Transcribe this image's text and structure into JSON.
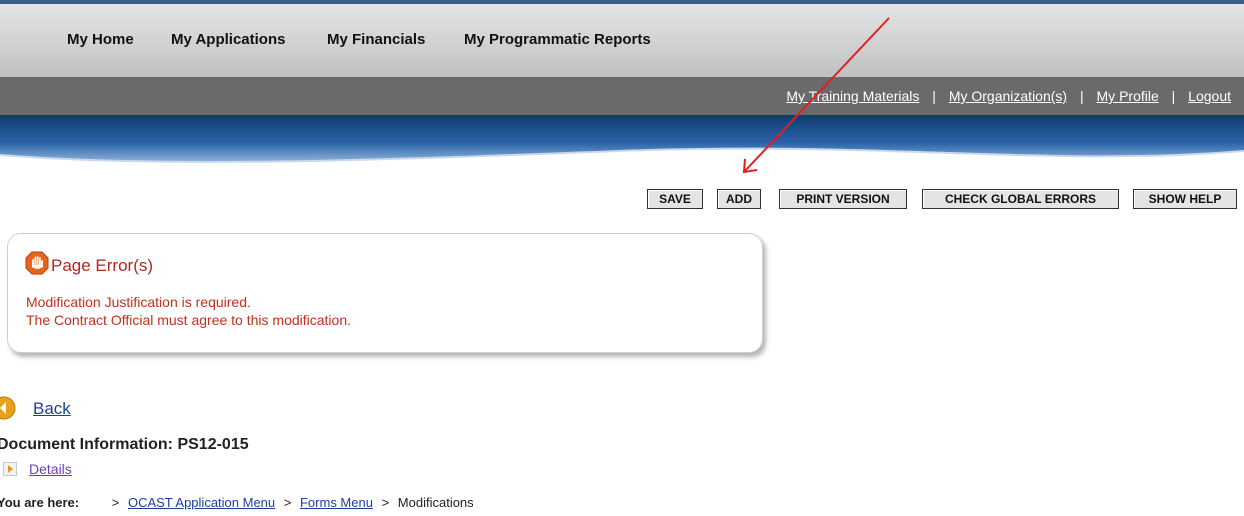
{
  "topnav": {
    "items": [
      "My Home",
      "My Applications",
      "My Financials",
      "My Programmatic Reports"
    ]
  },
  "subnav": {
    "links": [
      "My Training Materials",
      "My Organization(s)",
      "My Profile",
      "Logout"
    ],
    "separator": "|"
  },
  "toolbar": {
    "buttons": [
      "SAVE",
      "ADD",
      "PRINT VERSION",
      "CHECK GLOBAL ERRORS",
      "SHOW HELP"
    ]
  },
  "error_panel": {
    "title": "Page Error(s)",
    "messages": [
      "Modification Justification is required.",
      "The Contract Official must agree to this modification."
    ]
  },
  "back": {
    "label": "Back"
  },
  "document": {
    "label": "Document Information:",
    "id": "PS12-015",
    "details_label": "Details"
  },
  "breadcrumb": {
    "label": "You are here:",
    "separator": ">",
    "items": [
      "OCAST Application Menu",
      "Forms Menu",
      "Modifications"
    ]
  },
  "colors": {
    "error_text": "#c0311e",
    "link": "#1f3f99",
    "visited_link": "#6b3fb7",
    "subnav_bg": "#6a6a6a",
    "banner_blue": "#1d4f8c",
    "annotation_arrow": "#e02020"
  }
}
